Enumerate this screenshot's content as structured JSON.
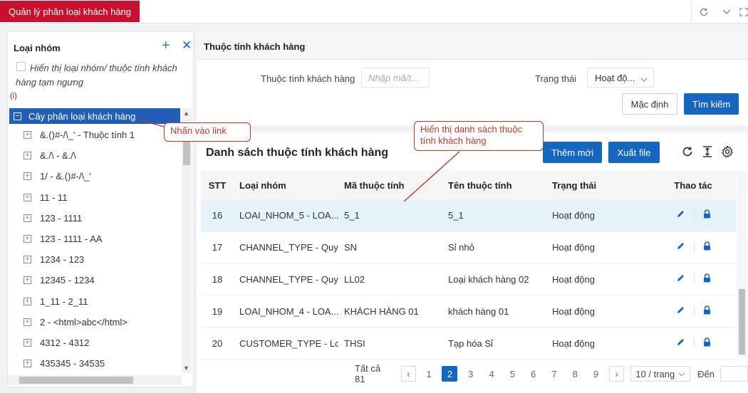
{
  "app": {
    "tab_title": "Quản lý phân loại khách hàng",
    "refresh_icon": "refresh-icon",
    "collapse_icon": "chevron-down-icon",
    "brand_color": "#c8102e",
    "primary_color": "#1566c0"
  },
  "left_panel": {
    "title": "Loại nhóm",
    "show_inactive_label": "Hiển thị loại nhóm/ thuộc tính khách hàng tạm ngưng",
    "info_note": "(i)",
    "tree_root": "Cây phân loại khách hàng",
    "tree_items": [
      "&.()#-/\\_' - Thuộc tính 1",
      "&./\\ - &./\\",
      "1/ - &.()#-/\\_'",
      "11 - 11",
      "123 - 1111",
      "123 - 1111 - AA",
      "1234 - 123",
      "12345 - 1234",
      "1_11 - 2_11",
      "2 - <html>abc</html>",
      "4312 - 4312",
      "435345 - 34535"
    ]
  },
  "right_panel": {
    "title": "Thuộc tính khách hàng",
    "filter": {
      "attr_label": "Thuộc tính khách hàng",
      "attr_placeholder": "Nhập mã/t...",
      "status_label": "Trạng thái",
      "status_value": "Hoạt độ...",
      "default_button": "Mặc định",
      "search_button": "Tìm kiếm"
    },
    "list": {
      "title": "Danh sách thuộc tính khách hàng",
      "add_button": "Thêm mới",
      "export_button": "Xuất file",
      "columns": [
        "STT",
        "Loại nhóm",
        "Mã thuộc tính",
        "Tên thuộc tính",
        "Trạng thái",
        "Thao tác"
      ],
      "rows": [
        {
          "stt": "16",
          "group": "LOAI_NHOM_5 - LOA...",
          "code": "5_1",
          "name": "5_1",
          "status": "Hoạt động",
          "highlight": true
        },
        {
          "stt": "17",
          "group": "CHANNEL_TYPE - Quy...",
          "code": "SN",
          "name": "Sỉ nhỏ",
          "status": "Hoạt động",
          "highlight": false
        },
        {
          "stt": "18",
          "group": "CHANNEL_TYPE - Quy...",
          "code": "LL02",
          "name": "Loại khách hàng 02",
          "status": "Hoạt động",
          "highlight": false
        },
        {
          "stt": "19",
          "group": "LOAI_NHOM_4 - LOA...",
          "code": "KHÁCH HÀNG 01",
          "name": "khách hàng 01",
          "status": "Hoạt động",
          "highlight": false
        },
        {
          "stt": "20",
          "group": "CUSTOMER_TYPE - Lo...",
          "code": "THSI",
          "name": "Tạp hóa Sỉ",
          "status": "Hoạt động",
          "highlight": false
        }
      ]
    },
    "pagination": {
      "total_label": "Tất cả 81",
      "pages": [
        "1",
        "2",
        "3",
        "4",
        "5",
        "6",
        "7",
        "8",
        "9"
      ],
      "current_page": "2",
      "page_size": "10 / trang",
      "goto_label": "Đến"
    }
  },
  "annotations": {
    "click_link": "Nhấn vào link",
    "show_list": "Hiển thị danh sách thuộc tính khách hàng",
    "color": "#c0392b"
  }
}
